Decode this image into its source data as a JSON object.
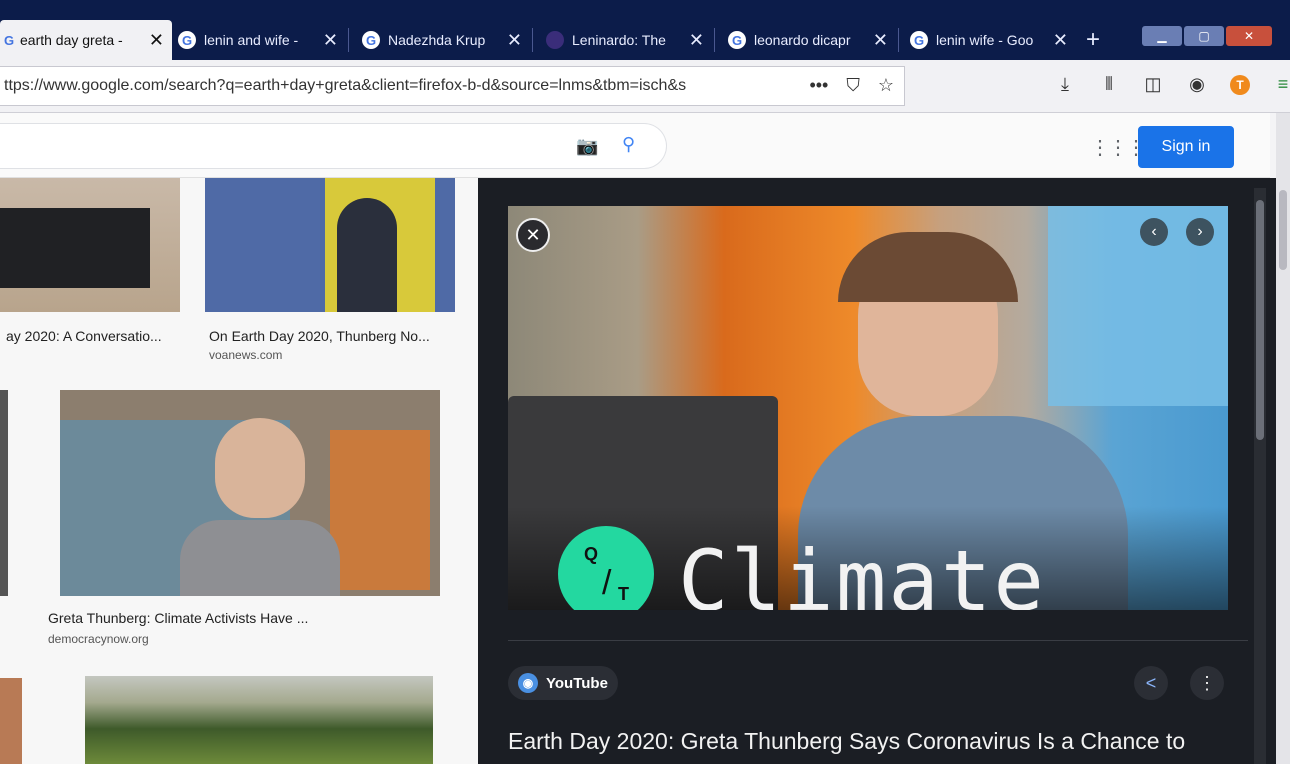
{
  "tabs": [
    {
      "label": "earth day greta -",
      "favicon": "google-icon",
      "active": true
    },
    {
      "label": "lenin and wife -",
      "favicon": "google-icon",
      "active": false
    },
    {
      "label": "Nadezhda Krup",
      "favicon": "google-icon",
      "active": false
    },
    {
      "label": "Leninardo: The",
      "favicon": "site-icon",
      "active": false
    },
    {
      "label": "leonardo dicapr",
      "favicon": "google-icon",
      "active": false
    },
    {
      "label": "lenin wife - Goo",
      "favicon": "google-icon",
      "active": false
    }
  ],
  "new_tab_label": "+",
  "url": "ttps://www.google.com/search?q=earth+day+greta&client=firefox-b-d&source=lnms&tbm=isch&s",
  "header": {
    "sign_in": "Sign in"
  },
  "results": [
    {
      "caption": "ay 2020: A Conversatio...",
      "source": ""
    },
    {
      "caption": "On Earth Day 2020, Thunberg No...",
      "source": "voanews.com"
    },
    {
      "caption": "Greta Thunberg: Climate Activists Have ...",
      "source": "democracynow.org"
    }
  ],
  "preview": {
    "logo_top": "Q",
    "logo_bottom": "T",
    "brand_text": "Climate",
    "source_name": "YouTube",
    "title": "Earth Day 2020: Greta Thunberg Says Coronavirus Is a Chance to"
  },
  "colors": {
    "tab_bar": "#0c1c4a",
    "sign_in": "#1a73e8",
    "qt_green": "#23d8a0"
  }
}
